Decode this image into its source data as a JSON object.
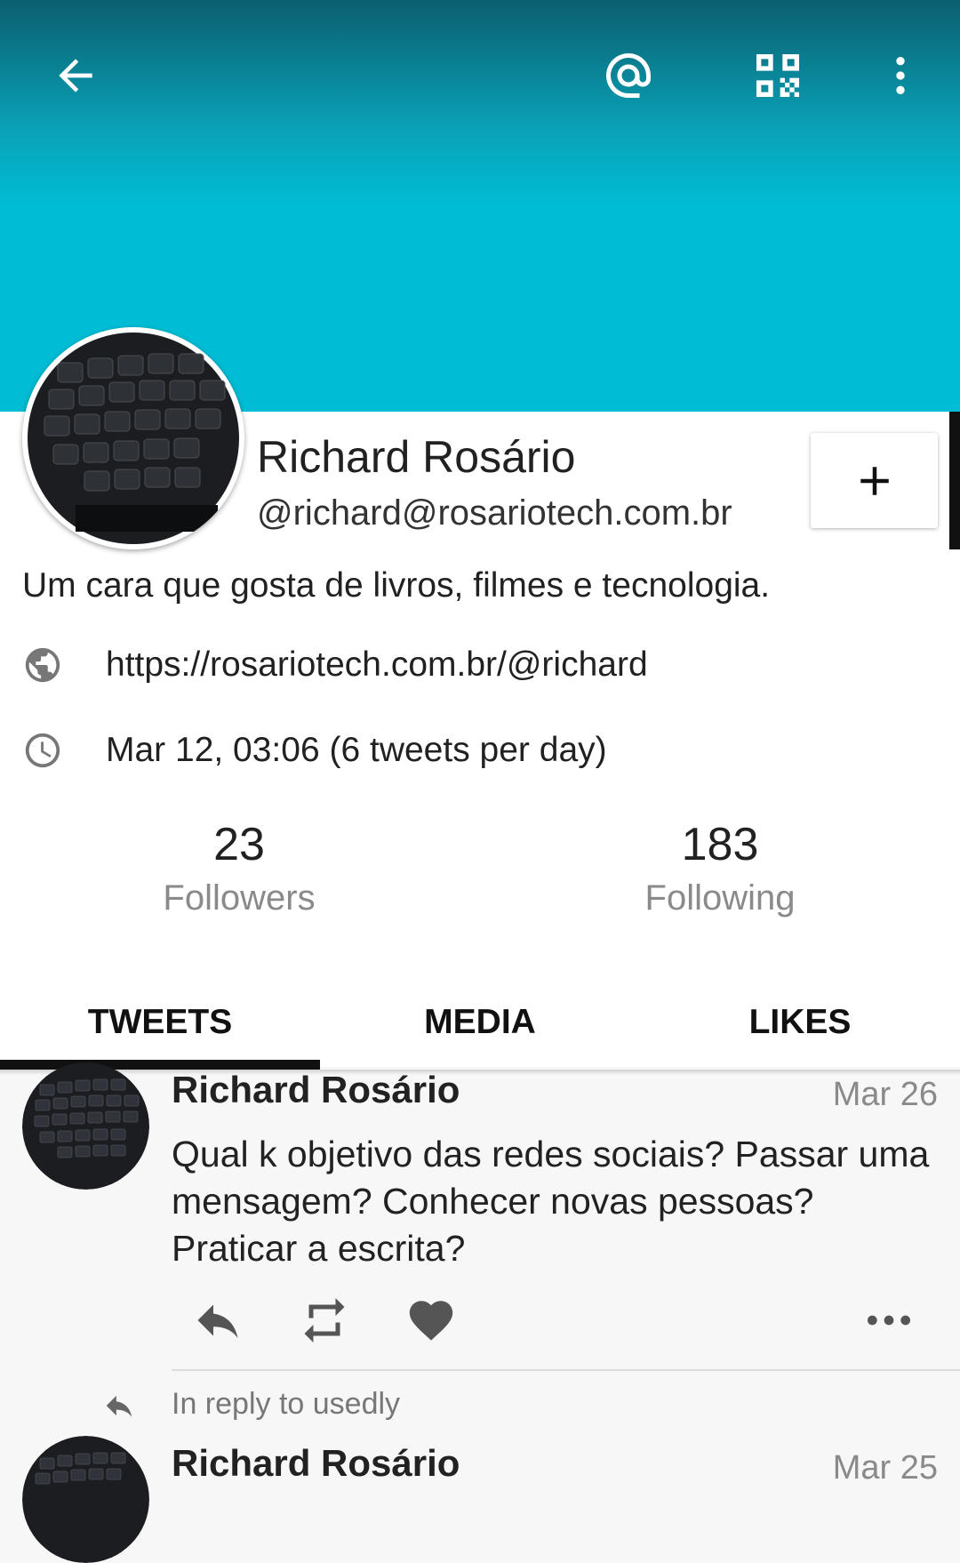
{
  "colors": {
    "banner": "#00bcd4",
    "banner_top": "#0b5f6f",
    "card": "#ffffff",
    "tab_indicator": "#111111"
  },
  "topbar": {
    "back_icon": "arrow-left-icon",
    "mention_icon": "at-sign-icon",
    "qr_icon": "qr-code-icon",
    "menu_icon": "more-vertical-icon"
  },
  "profile": {
    "name": "Richard Rosário",
    "handle": "@richard@rosariotech.com.br",
    "bio": "Um cara que gosta de livros, filmes e tecnologia.",
    "website": "https://rosariotech.com.br/@richard",
    "joined": "Mar 12, 03:06 (6 tweets per day)",
    "follow_icon": "plus-icon"
  },
  "stats": {
    "followers": {
      "count": "23",
      "label": "Followers"
    },
    "following": {
      "count": "183",
      "label": "Following"
    }
  },
  "tabs": [
    {
      "label": "TWEETS",
      "active": true
    },
    {
      "label": "MEDIA",
      "active": false
    },
    {
      "label": "LIKES",
      "active": false
    }
  ],
  "tweets": [
    {
      "author": "Richard Rosário",
      "date": "Mar 26",
      "text": "Qual k objetivo das redes sociais? Passar uma mensagem? Conhecer novas pessoas? Praticar a escrita?",
      "actions": [
        "reply-icon",
        "retweet-icon",
        "heart-icon",
        "more-horizontal-icon"
      ]
    },
    {
      "reply_note": "In reply to usedly",
      "author": "Richard Rosário",
      "date": "Mar 25"
    }
  ]
}
